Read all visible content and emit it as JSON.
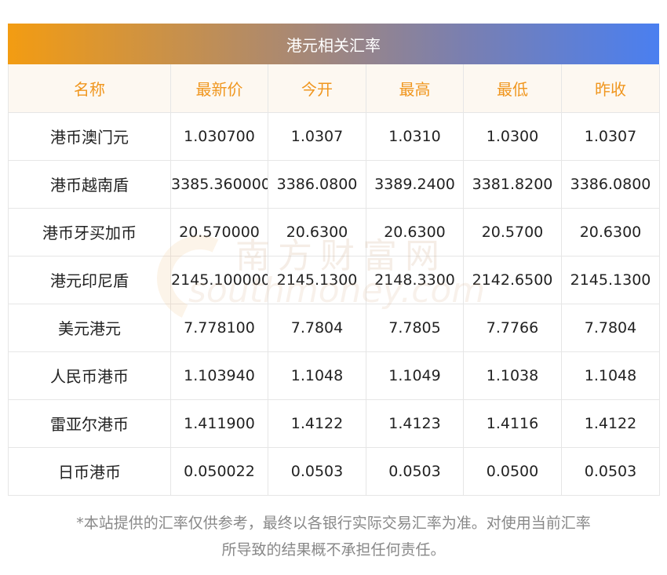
{
  "title": "港元相关汇率",
  "headers": [
    "名称",
    "最新价",
    "今开",
    "最高",
    "最低",
    "昨收"
  ],
  "rows": [
    {
      "name": "港币澳门元",
      "latest": "1.030700",
      "open": "1.0307",
      "high": "1.0310",
      "low": "1.0300",
      "prev": "1.0307"
    },
    {
      "name": "港币越南盾",
      "latest": "3385.360000",
      "open": "3386.0800",
      "high": "3389.2400",
      "low": "3381.8200",
      "prev": "3386.0800"
    },
    {
      "name": "港币牙买加币",
      "latest": "20.570000",
      "open": "20.6300",
      "high": "20.6300",
      "low": "20.5700",
      "prev": "20.6300"
    },
    {
      "name": "港元印尼盾",
      "latest": "2145.100000",
      "open": "2145.1300",
      "high": "2148.3300",
      "low": "2142.6500",
      "prev": "2145.1300"
    },
    {
      "name": "美元港元",
      "latest": "7.778100",
      "open": "7.7804",
      "high": "7.7805",
      "low": "7.7766",
      "prev": "7.7804"
    },
    {
      "name": "人民币港币",
      "latest": "1.103940",
      "open": "1.1048",
      "high": "1.1049",
      "low": "1.1038",
      "prev": "1.1048"
    },
    {
      "name": "雷亚尔港币",
      "latest": "1.411900",
      "open": "1.4122",
      "high": "1.4123",
      "low": "1.4116",
      "prev": "1.4122"
    },
    {
      "name": "日币港币",
      "latest": "0.050022",
      "open": "0.0503",
      "high": "0.0503",
      "low": "0.0500",
      "prev": "0.0503"
    }
  ],
  "watermark": {
    "cn": "南方财富网",
    "en": "southmoney.com"
  },
  "note_line1": "*本站提供的汇率仅供参考，最终以各银行实际交易汇率为准。对使用当前汇率",
  "note_line2": "所导致的结果概不承担任何责任。",
  "colors": {
    "header_text": "#f0961e",
    "header_bg": "#fdf8f1",
    "banner_start": "#f39c12",
    "banner_end": "#4a7ff0"
  }
}
